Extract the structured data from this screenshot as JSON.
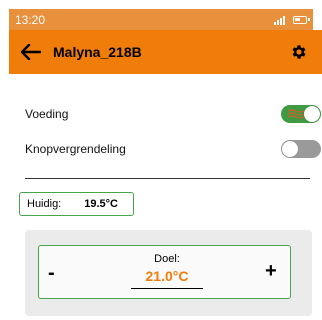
{
  "status_bar": {
    "time": "13:20"
  },
  "app_bar": {
    "title": "Malyna_218B"
  },
  "settings": [
    {
      "label": "Voeding",
      "state": "on"
    },
    {
      "label": "Knopvergrendeling",
      "state": "off"
    }
  ],
  "current": {
    "label": "Huidig:",
    "value": "19.5°C"
  },
  "target": {
    "label": "Doel:",
    "value": "21.0°C",
    "minus": "-",
    "plus": "+"
  },
  "colors": {
    "status_bar": "#e9903c",
    "accent": "#f07c0a",
    "toggle_on": "#3e9a43",
    "toggle_off": "#9a9a9a",
    "border": "#46a44a"
  }
}
